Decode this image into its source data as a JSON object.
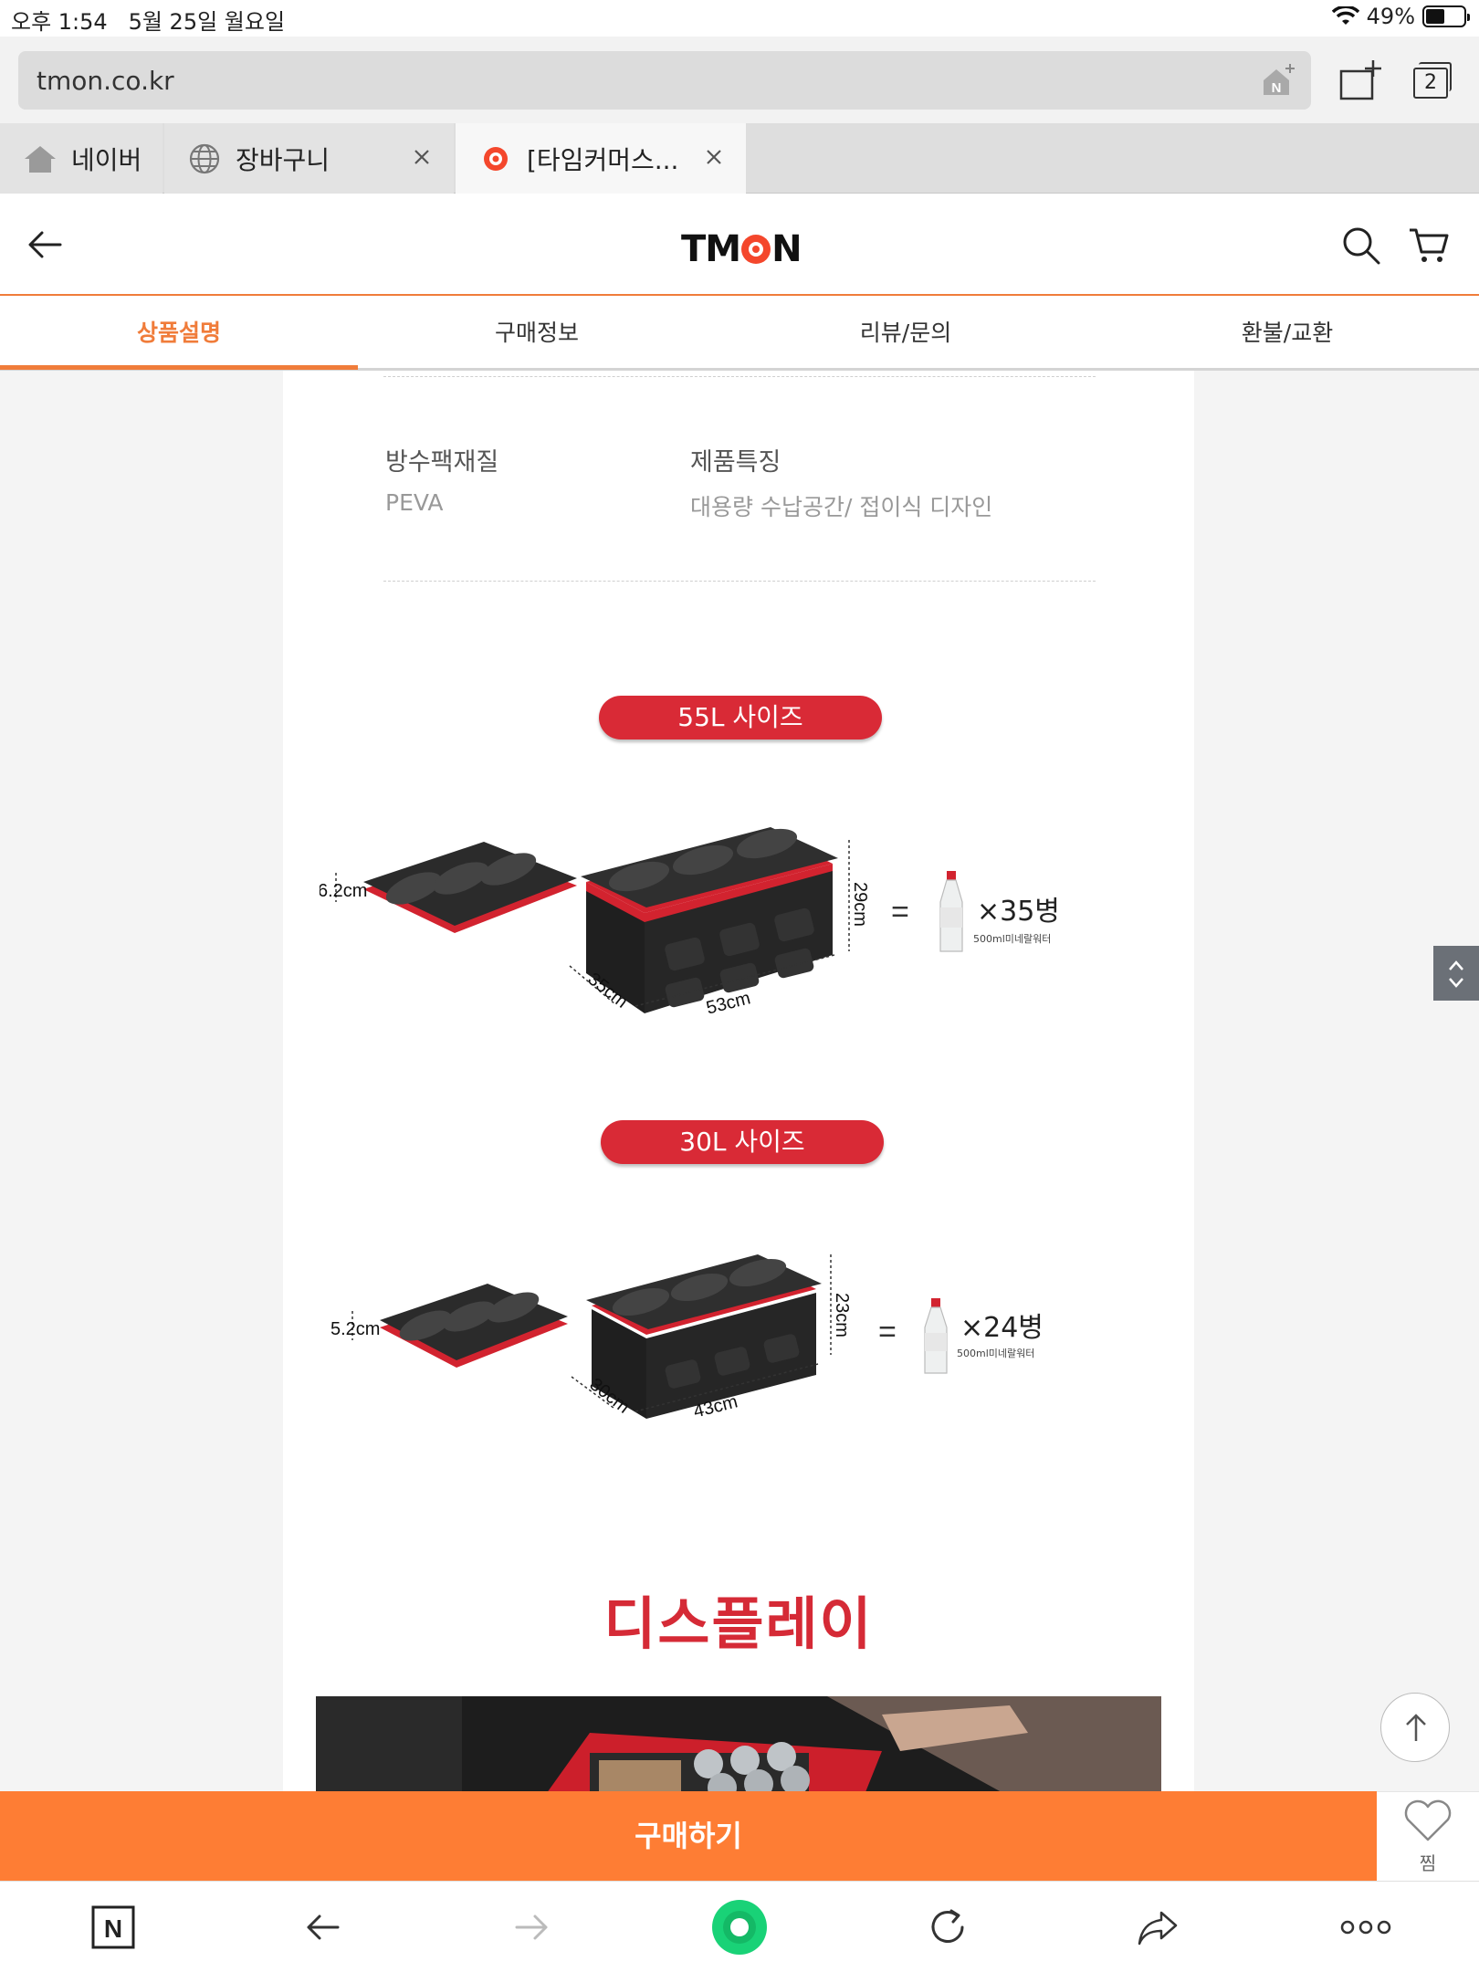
{
  "status_bar": {
    "time": "오후 1:54",
    "date": "5월 25일 월요일",
    "battery": "49%",
    "battery_level": 0.49
  },
  "browser": {
    "url": "tmon.co.kr",
    "tab_count": "2",
    "tabs": [
      {
        "label": "네이버",
        "icon": "home-icon"
      },
      {
        "label": "장바구니",
        "icon": "globe-icon"
      },
      {
        "label": "[타임커머스...",
        "icon": "tmon-favicon"
      }
    ]
  },
  "header": {
    "logo": "TMON"
  },
  "product_tabs": [
    "상품설명",
    "구매정보",
    "리뷰/문의",
    "환불/교환"
  ],
  "specs": [
    {
      "label": "방수팩재질",
      "value": "PEVA"
    },
    {
      "label": "제품특징",
      "value": "대용량 수납공간/ 접이식 디자인"
    }
  ],
  "sizes": [
    {
      "title": "55L 사이즈",
      "folded_height": "6.2cm",
      "height": "29cm",
      "depth": "35cm",
      "width": "53cm",
      "bottles": "×35병",
      "bottle_note": "500ml미네랄워터"
    },
    {
      "title": "30L 사이즈",
      "folded_height": "5.2cm",
      "height": "23cm",
      "depth": "30cm",
      "width": "43cm",
      "bottles": "×24병",
      "bottle_note": "500ml미네랄워터"
    }
  ],
  "display_heading": "디스플레이",
  "buy_button": "구매하기",
  "wish_label": "찜",
  "colors": {
    "accent": "#fe7d34",
    "pill_red": "#d92a36",
    "heading_red": "#d52a36"
  }
}
